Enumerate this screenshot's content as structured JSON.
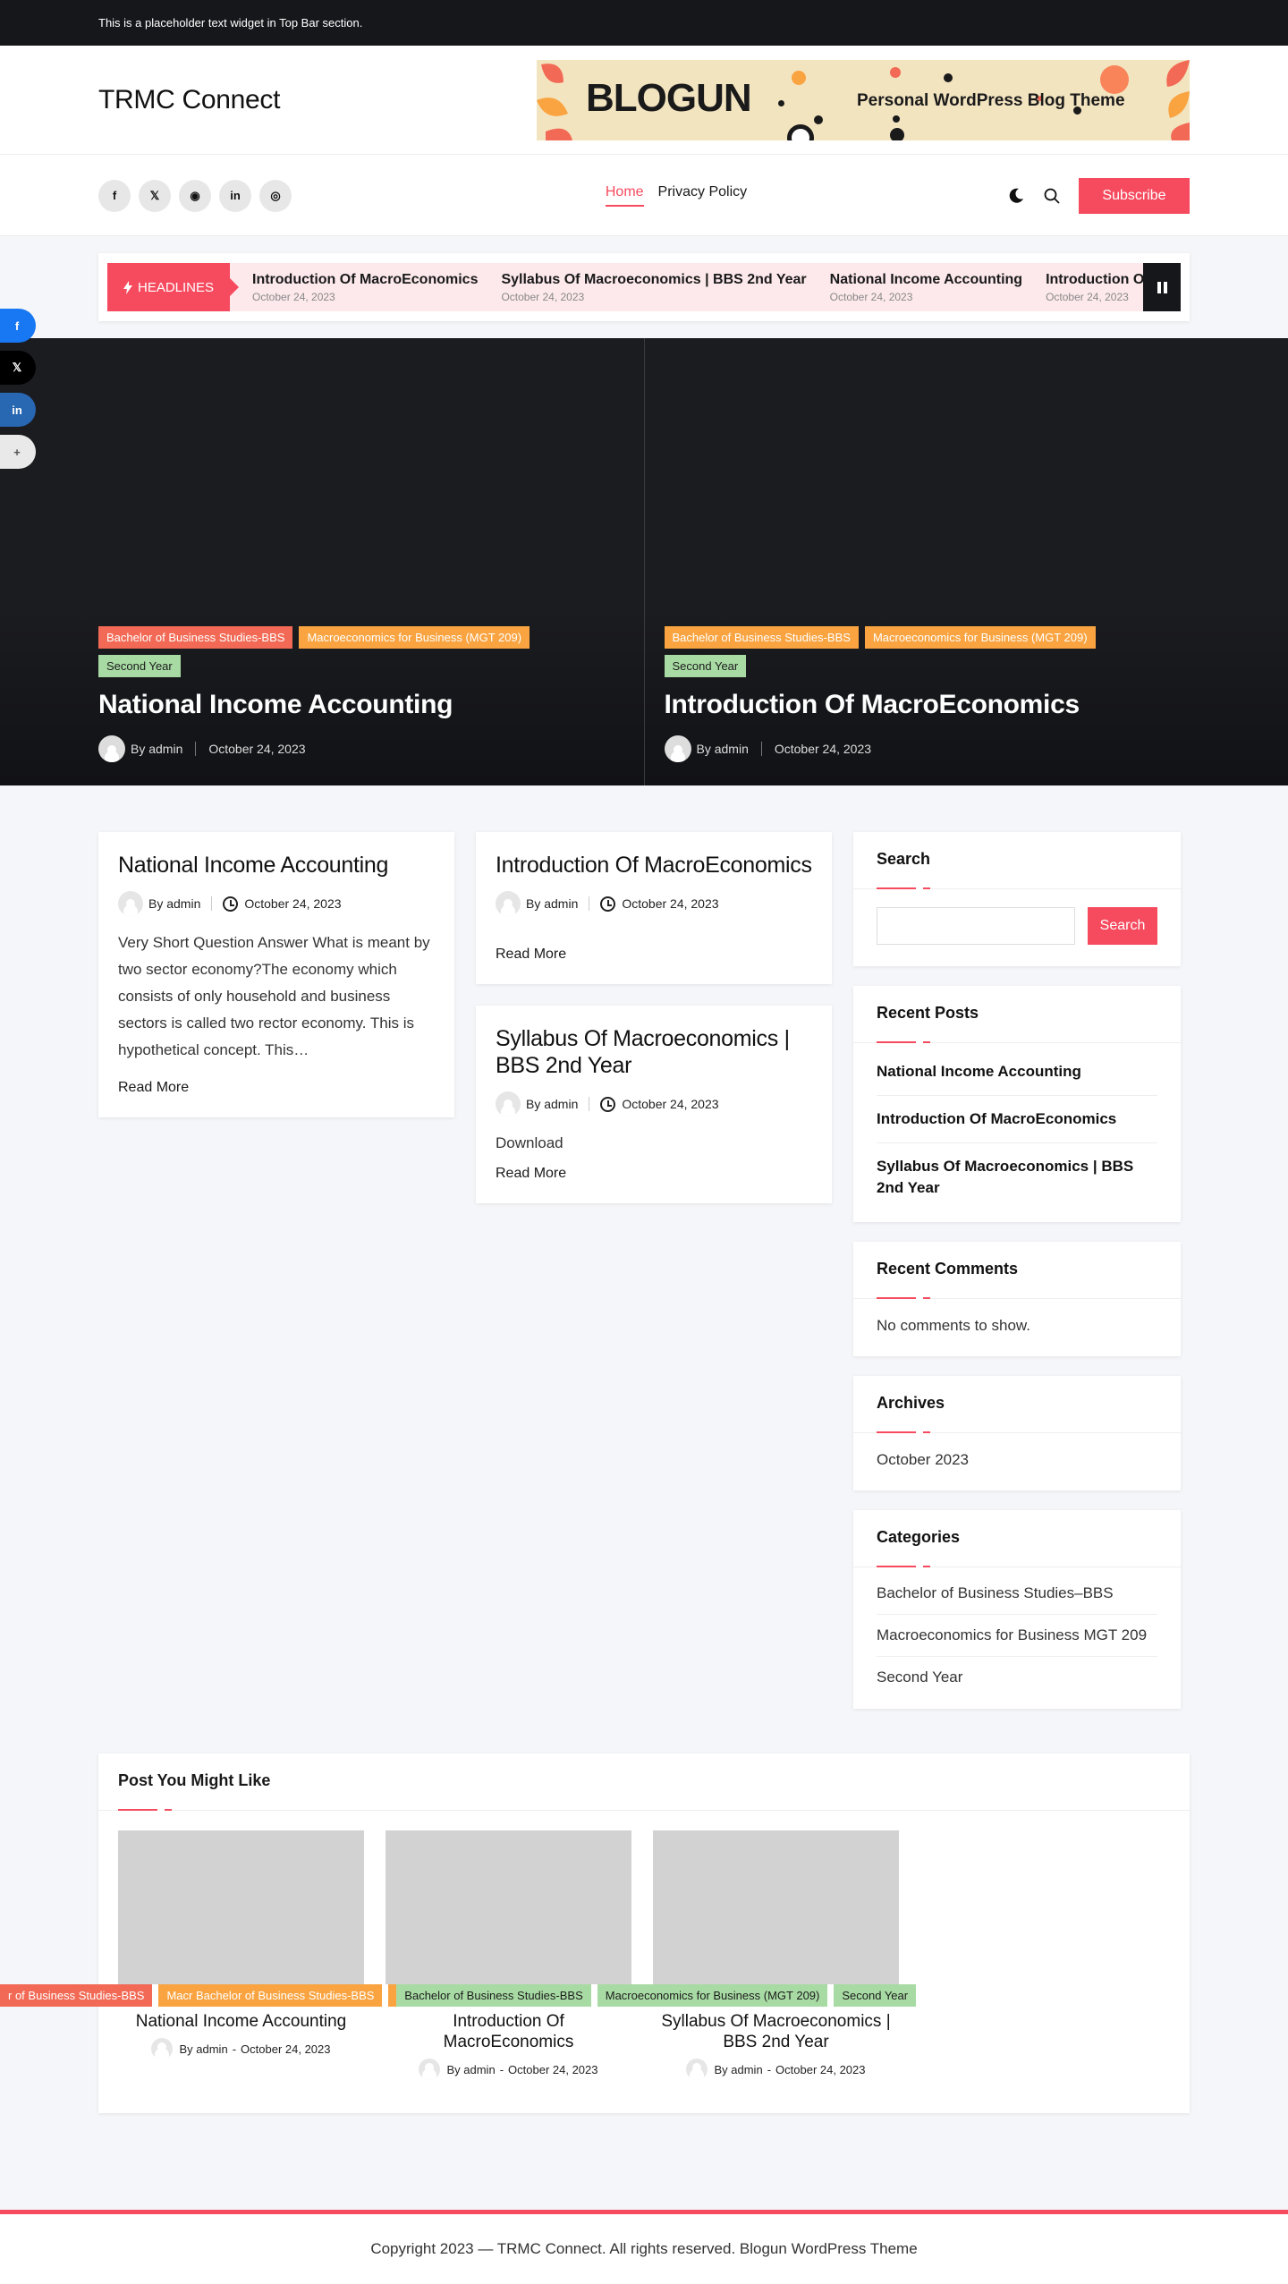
{
  "topbar": {
    "text": "This is a placeholder text widget in Top Bar section."
  },
  "header": {
    "site_title": "TRMC Connect",
    "banner": {
      "brand": "BLOGUN",
      "tagline": "Personal WordPress Blog Theme"
    }
  },
  "nav": {
    "socials": [
      {
        "icon": "facebook-icon",
        "glyph": "f"
      },
      {
        "icon": "x-icon",
        "glyph": "𝕏"
      },
      {
        "icon": "rss-icon",
        "glyph": "◉"
      },
      {
        "icon": "linkedin-icon",
        "glyph": "in"
      },
      {
        "icon": "instagram-icon",
        "glyph": "◎"
      }
    ],
    "menu": [
      {
        "label": "Home",
        "active": true
      },
      {
        "label": "Privacy Policy",
        "active": false
      }
    ],
    "subscribe_label": "Subscribe"
  },
  "ticker": {
    "label": "HEADLINES",
    "items": [
      {
        "title": "Introduction Of MacroEconomics",
        "date": "October 24, 2023"
      },
      {
        "title": "Syllabus Of Macroeconomics | BBS 2nd Year",
        "date": "October 24, 2023"
      },
      {
        "title": "National Income Accounting",
        "date": "October 24, 2023"
      },
      {
        "title": "Introduction Of MacroEconomics",
        "date": "October 24, 2023"
      }
    ]
  },
  "hero": [
    {
      "tags": [
        "Bachelor of Business Studies-BBS",
        "Macroeconomics for Business (MGT 209)",
        "Second Year"
      ],
      "title": "National Income Accounting",
      "author": "By admin",
      "date": "October 24, 2023"
    },
    {
      "tags": [
        "Bachelor of Business Studies-BBS",
        "Macroeconomics for Business (MGT 209)",
        "Second Year"
      ],
      "title": "Introduction Of MacroEconomics",
      "author": "By admin",
      "date": "October 24, 2023"
    }
  ],
  "posts": [
    {
      "title": "National Income Accounting",
      "author": "By admin",
      "date": "October 24, 2023",
      "excerpt": "Very Short Question Answer What is meant by two sector economy?The economy which consists of only household and business sectors is called two rector economy. This is hypothetical concept. This…",
      "read_more": "Read More"
    },
    {
      "title": "Introduction Of MacroEconomics",
      "author": "By admin",
      "date": "October 24, 2023",
      "excerpt": "",
      "read_more": "Read More"
    },
    {
      "title": "Syllabus Of Macroeconomics | BBS 2nd Year",
      "author": "By admin",
      "date": "October 24, 2023",
      "excerpt": "Download",
      "read_more": "Read More"
    }
  ],
  "sidebar": {
    "search": {
      "title": "Search",
      "placeholder": "",
      "button": "Search"
    },
    "recent_posts": {
      "title": "Recent Posts",
      "items": [
        "National Income Accounting",
        "Introduction Of MacroEconomics",
        "Syllabus Of Macroeconomics | BBS 2nd Year"
      ]
    },
    "recent_comments": {
      "title": "Recent Comments",
      "text": "No comments to show."
    },
    "archives": {
      "title": "Archives",
      "items": [
        "October 2023"
      ]
    },
    "categories": {
      "title": "Categories",
      "items": [
        "Bachelor of Business Studies–BBS",
        "Macroeconomics for Business MGT 209",
        "Second Year"
      ]
    }
  },
  "related": {
    "title": "Post You Might Like",
    "tag_strip": [
      "r of Business Studies-BBS",
      "Macr Bachelor of Business Studies-BBS",
      "Macr",
      "Bachelor of Business Studies-BBS",
      "Macroeconomics for Business (MGT 209)",
      "Second Year"
    ],
    "items": [
      {
        "title": "National Income Accounting",
        "author": "By admin",
        "date": "October 24, 2023"
      },
      {
        "title": "Introduction Of MacroEconomics",
        "author": "By admin",
        "date": "October 24, 2023"
      },
      {
        "title": "Syllabus Of Macroeconomics | BBS 2nd Year",
        "author": "By admin",
        "date": "October 24, 2023"
      }
    ]
  },
  "footer": {
    "text": "Copyright 2023 — TRMC Connect. All rights reserved. Blogun WordPress Theme"
  },
  "share": [
    {
      "icon": "facebook-icon",
      "glyph": "f",
      "color": "#1877f2"
    },
    {
      "icon": "x-icon",
      "glyph": "𝕏",
      "color": "#000000"
    },
    {
      "icon": "linkedin-icon",
      "glyph": "in",
      "color": "#2867b2"
    },
    {
      "icon": "more-icon",
      "glyph": "+",
      "color": "#e9e9e9"
    }
  ],
  "colors": {
    "accent": "#f64a5e",
    "dark": "#16171b",
    "tag_red": "#f26a55",
    "tag_orange": "#f9a441",
    "tag_green": "#a8dba4"
  }
}
